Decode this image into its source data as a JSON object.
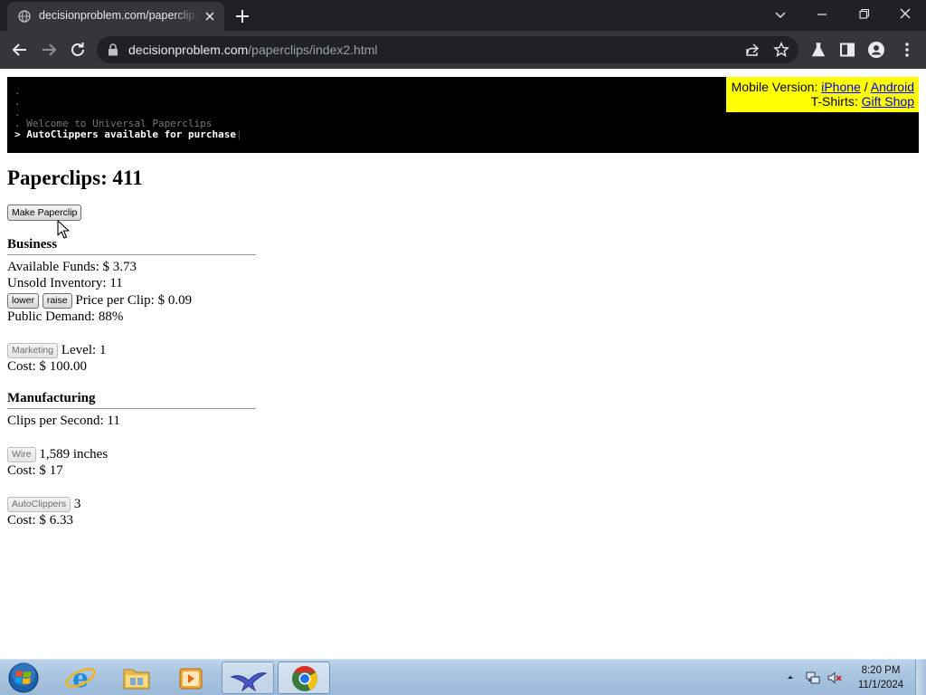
{
  "browser": {
    "tab_title": "decisionproblem.com/paperclips/index2.html",
    "url_host": "decisionproblem.com",
    "url_path": "/paperclips/index2.html"
  },
  "console": {
    "lines": [
      ".",
      ".",
      ".",
      ". Welcome to Universal Paperclips"
    ],
    "current": "> AutoClippers available for purchase",
    "cursor": "|"
  },
  "promo": {
    "mobile_label": "Mobile Version:",
    "iphone": "iPhone",
    "separator": "/",
    "android": "Android",
    "tshirts_label": "T-Shirts:",
    "gift_shop": "Gift Shop"
  },
  "game": {
    "paperclips_label": "Paperclips:",
    "paperclips": "411",
    "make_button": "Make Paperclip"
  },
  "business": {
    "title": "Business",
    "funds_label": "Available Funds: $",
    "funds": "3.73",
    "inventory_label": "Unsold Inventory:",
    "inventory": "11",
    "lower_button": "lower",
    "raise_button": "raise",
    "price_label": "Price per Clip: $",
    "price": "0.09",
    "demand_label": "Public Demand:",
    "demand": "88%",
    "marketing_button": "Marketing",
    "level_label": "Level:",
    "level": "1",
    "cost_label": "Cost: $",
    "marketing_cost": "100.00"
  },
  "manufacturing": {
    "title": "Manufacturing",
    "cps_label": "Clips per Second:",
    "cps": "11",
    "wire_button": "Wire",
    "wire_amount": "1,589",
    "wire_unit": "inches",
    "cost_label": "Cost: $",
    "wire_cost": "17",
    "autoclippers_button": "AutoClippers",
    "autoclippers": "3",
    "autoclippers_cost": "6.33"
  },
  "taskbar": {
    "time": "8:20 PM",
    "date": "11/1/2024"
  }
}
